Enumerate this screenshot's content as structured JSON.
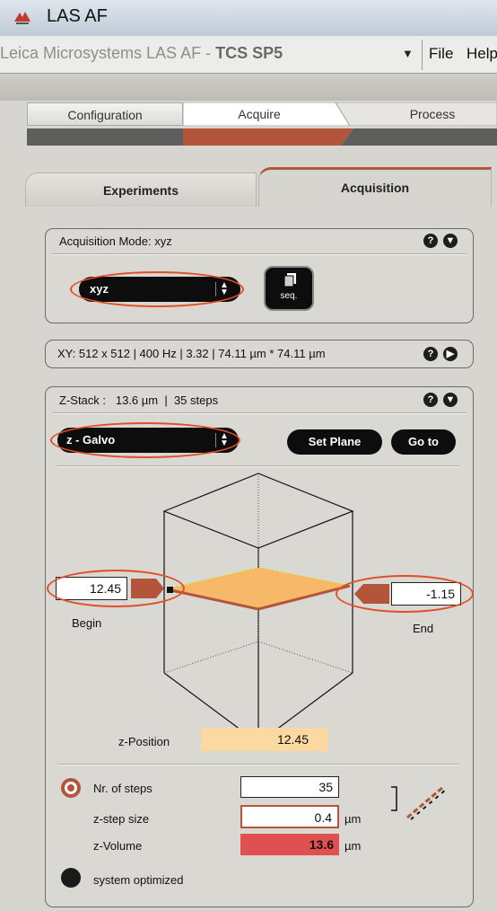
{
  "window": {
    "title": "LAS AF"
  },
  "menubar": {
    "app_name": "Leica Microsystems LAS AF",
    "separator": " - ",
    "system": "TCS SP5",
    "dropdown_arrow": "▼",
    "file": "File",
    "help": "Help"
  },
  "workflow_tabs": [
    {
      "label": "Configuration"
    },
    {
      "label": "Acquire"
    },
    {
      "label": "Process"
    }
  ],
  "side_tabs": {
    "experiments": "Experiments",
    "acquisition": "Acquisition"
  },
  "acquisition_mode": {
    "header": "Acquisition Mode: xyz",
    "selected": "xyz",
    "seq_label": "seq."
  },
  "xy_panel": {
    "header": "XY:  512 x 512 | 400 Hz | 3.32 | 74.11 µm * 74.11 µm"
  },
  "z_stack": {
    "header_label": "Z-Stack :",
    "header_size": "13.6 µm",
    "header_sep": "|",
    "header_steps": "35 steps",
    "z_device": "z - Galvo",
    "set_plane": "Set Plane",
    "go_to": "Go to",
    "begin_value": "12.45",
    "begin_label": "Begin",
    "end_value": "-1.15",
    "end_label": "End",
    "z_position_label": "z-Position",
    "z_position_value": "12.45",
    "nr_steps_label": "Nr. of steps",
    "nr_steps_value": "35",
    "step_size_label": "z-step size",
    "step_size_value": "0.4",
    "step_size_unit": "µm",
    "volume_label": "z-Volume",
    "volume_value": "13.6",
    "volume_unit": "µm",
    "system_optimized_label": "system optimized"
  },
  "colors": {
    "accent": "#b3553a",
    "highlight_ring": "#e05028",
    "volume_fill": "#e05050",
    "plane_fill": "#f7b86a",
    "z_position_fill": "#fbd9a0"
  }
}
